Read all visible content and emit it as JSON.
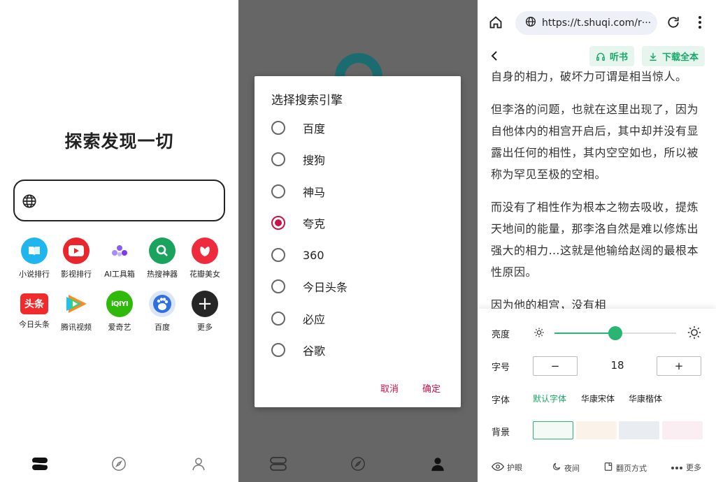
{
  "panel1": {
    "title": "探索发现一切",
    "search_icon": "globe-icon",
    "apps": [
      {
        "label": "小说排行",
        "icon": "book-icon",
        "color": "#1fb6f0",
        "glyph": ""
      },
      {
        "label": "影视排行",
        "icon": "play-icon",
        "color": "#e9262c",
        "glyph": ""
      },
      {
        "label": "AI工具箱",
        "icon": "ai-icon",
        "color": "#ffffff",
        "glyph": ""
      },
      {
        "label": "热搜神器",
        "icon": "search-icon",
        "color": "#1aa35c",
        "glyph": ""
      },
      {
        "label": "花瓣美女",
        "icon": "petal-icon",
        "color": "#ee2a3c",
        "glyph": ""
      },
      {
        "label": "今日头条",
        "icon": "toutiao-icon",
        "color": "#ef2b2b",
        "glyph": "头条"
      },
      {
        "label": "腾讯视频",
        "icon": "tencent-video-icon",
        "color": "#ffffff",
        "glyph": ""
      },
      {
        "label": "爱奇艺",
        "icon": "iqiyi-icon",
        "color": "#2fb90a",
        "glyph": "iQIYI"
      },
      {
        "label": "百度",
        "icon": "baidu-icon",
        "color": "#dbe6fb",
        "glyph": ""
      },
      {
        "label": "更多",
        "icon": "plus-icon",
        "color": "#262626",
        "glyph": "+"
      }
    ],
    "nav": [
      "home-logo-icon",
      "compass-icon",
      "profile-icon"
    ]
  },
  "panel2": {
    "dialog_title": "选择搜索引擎",
    "options": [
      "百度",
      "搜狗",
      "神马",
      "夸克",
      "360",
      "今日头条",
      "必应",
      "谷歌"
    ],
    "selected": "夸克",
    "cancel_label": "取消",
    "confirm_label": "确定",
    "accent": "#c8144a"
  },
  "panel3": {
    "url": "https://t.shuqi.com/r···",
    "listen_label": "听书",
    "download_label": "下载全本",
    "paragraphs": [
      "自身的相力，破坏力可谓是相当惊人。",
      "但李洛的问题，也就在这里出现了，因为自他体内的相宫开启后，其中却并没有显露出任何的相性，其内空空如也，所以被称为罕见至极的空相。",
      "而没有了相性作为根本之物去吸收，提炼天地间的能量，那李洛自然是难以修炼出强大的相力…这就是他输给赵阔的最根本性原因。",
      "因为他的相宫，没有相"
    ],
    "brightness_label": "亮度",
    "brightness": 0.5,
    "fontsize_label": "字号",
    "fontsize_minus": "−",
    "fontsize_value": "18",
    "fontsize_plus": "+",
    "font_label": "字体",
    "fonts": [
      "默认字体",
      "华康宋体",
      "华康楷体"
    ],
    "selected_font": "默认字体",
    "background_label": "背景",
    "backgrounds": [
      "#f4fbf7",
      "#fbf3ea",
      "#e9edf2",
      "#fbeef2"
    ],
    "bottom": [
      "护眼",
      "夜间",
      "翻页方式",
      "更多"
    ],
    "accent": "#17a868"
  }
}
